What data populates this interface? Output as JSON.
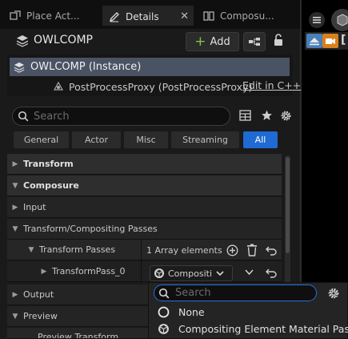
{
  "tabs": [
    {
      "label": "Place Act...",
      "icon": "place-actors-icon",
      "active": false
    },
    {
      "label": "Details",
      "icon": "details-pencil-icon",
      "active": true,
      "close": "✕"
    },
    {
      "label": "Composu...",
      "icon": "composure-icon",
      "active": false
    }
  ],
  "header": {
    "title": "OWLCOMP",
    "add_label": "Add",
    "add_symbol": "+"
  },
  "tree": {
    "instance_label": "OWLCOMP (Instance)",
    "child_label": "PostProcessProxy (PostProcessProxy)",
    "edit_link": "Edit in C++"
  },
  "search": {
    "placeholder": "Search"
  },
  "filters": [
    "General",
    "Actor",
    "Misc",
    "Streaming",
    "All"
  ],
  "active_filter": "All",
  "properties": {
    "transform": "Transform",
    "composure": "Composure",
    "input": "Input",
    "passes": "Transform/Compositing Passes",
    "transform_passes": "Transform Passes",
    "array_count": "1 Array elements",
    "pass_0": "TransformPass_0",
    "pass_0_value": "Compositi",
    "output": "Output",
    "preview": "Preview",
    "preview_transform": "Preview Transform"
  },
  "dropdown": {
    "search_placeholder": "Search",
    "items": [
      {
        "label": "None",
        "icon": "none-circle-icon"
      },
      {
        "label": "Compositing Element Material Pass",
        "icon": "material-pass-icon"
      }
    ]
  },
  "colors": {
    "accent": "#1f6ad3",
    "selection": "#4a5363",
    "add_plus": "#7fc242",
    "cam_blue": "#4a7fb8",
    "cam_orange": "#d9801c"
  }
}
